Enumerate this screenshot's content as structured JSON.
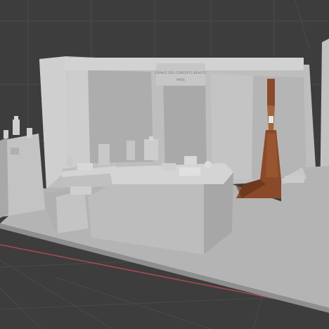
{
  "viewport": {
    "background": "#3d3d3d",
    "grid_color": "#4a4a4a",
    "x_axis_color": "#b34a55"
  },
  "scene": {
    "sign_line_1": "ESPACE DES CONCEPTS BEAUTE",
    "sign_line_2": "PARIS"
  },
  "colors": {
    "model_light": "#c8c8c8",
    "model_mid": "#b9b9b9",
    "model_dark": "#a6a6a6",
    "model_shadow": "#8f8f8f",
    "wood": "#8a4a2a",
    "wood_dark": "#5e2f18"
  }
}
